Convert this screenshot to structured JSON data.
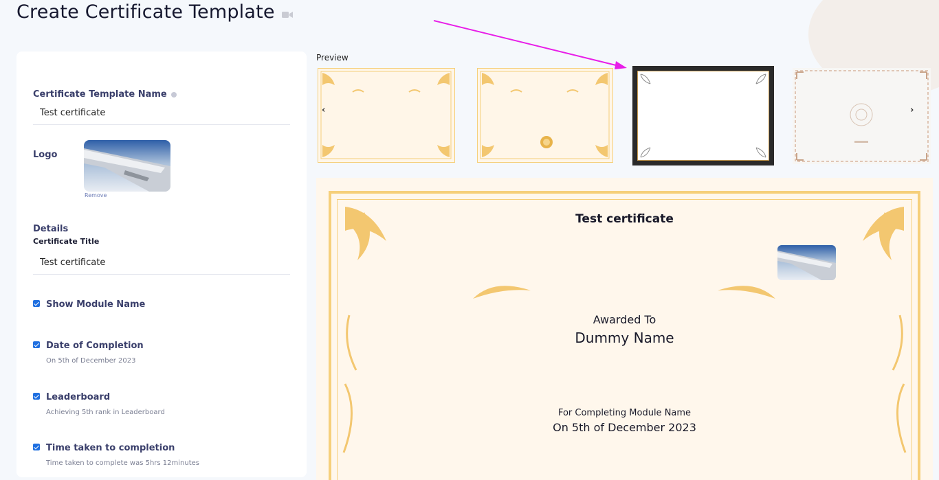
{
  "header": {
    "title": "Create Certificate Template",
    "video_icon": "video-camera-icon"
  },
  "form": {
    "template_name_label": "Certificate Template Name",
    "template_name_value": "Test certificate",
    "logo_label": "Logo",
    "remove_label": "Remove",
    "details_label": "Details",
    "certificate_title_label": "Certificate Title",
    "certificate_title_value": "Test certificate",
    "options": [
      {
        "label": "Show Module Name",
        "desc": "",
        "checked": true
      },
      {
        "label": "Date of Completion",
        "desc": "On 5th of December 2023",
        "checked": true
      },
      {
        "label": "Leaderboard",
        "desc": "Achieving 5th rank in Leaderboard",
        "checked": true
      },
      {
        "label": "Time taken to completion",
        "desc": "Time taken to complete was 5hrs 12minutes",
        "checked": true
      }
    ]
  },
  "preview": {
    "label": "Preview",
    "prev_arrow": "‹",
    "next_arrow": "›",
    "selected_index": 2
  },
  "certificate": {
    "title": "Test certificate",
    "awarded_label": "Awarded To",
    "name": "Dummy Name",
    "completing_text": "For Completing Module Name",
    "date_text": "On 5th of December 2023"
  },
  "colors": {
    "accent": "#1f6fe0",
    "gold": "#f6cf7a",
    "annotation_arrow": "#e81ee8"
  }
}
